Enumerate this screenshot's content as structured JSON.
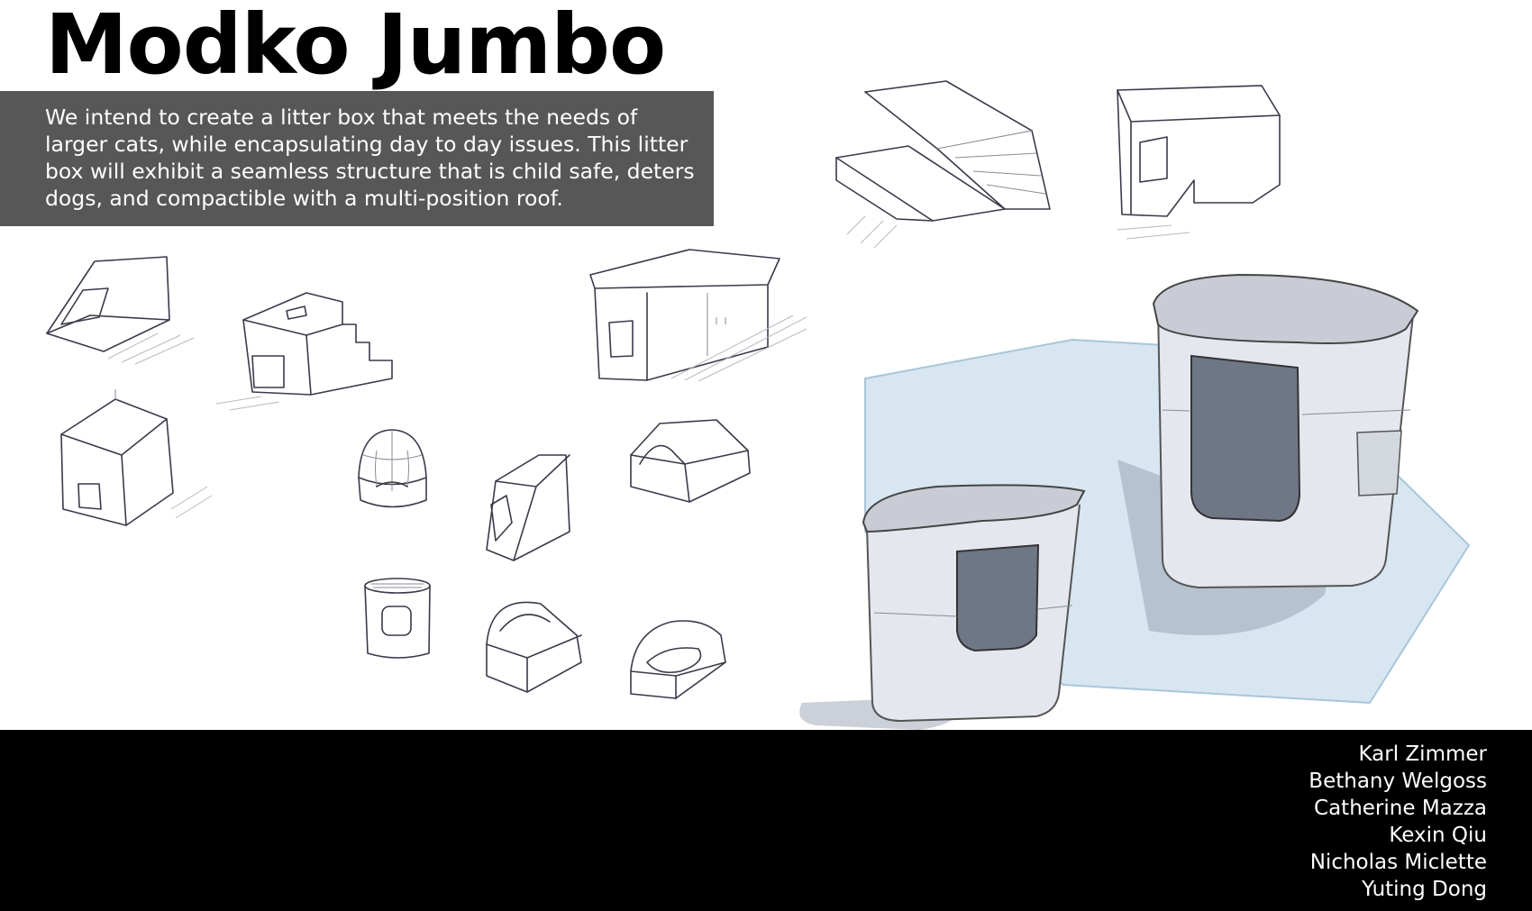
{
  "title": "Modko Jumbo",
  "description": "We intend to create a litter box that meets the needs of\nlarger cats, while encapsulating day to day issues.  This litter\nbox will exhibit a seamless structure that is child safe, deters\ndogs, and compactible with a multi-position roof.",
  "team": [
    "Karl Zimmer",
    "Bethany Welgoss",
    "Catherine Mazza",
    "Kexin Qiu",
    "Nicholas Miclette",
    "Yuting Dong"
  ],
  "colors": {
    "description_bg": "#575757",
    "footer_bg": "#000000",
    "render_base": "#d7e6f0",
    "render_body": "#e4e7ee",
    "render_shadow": "#8e97a8"
  }
}
